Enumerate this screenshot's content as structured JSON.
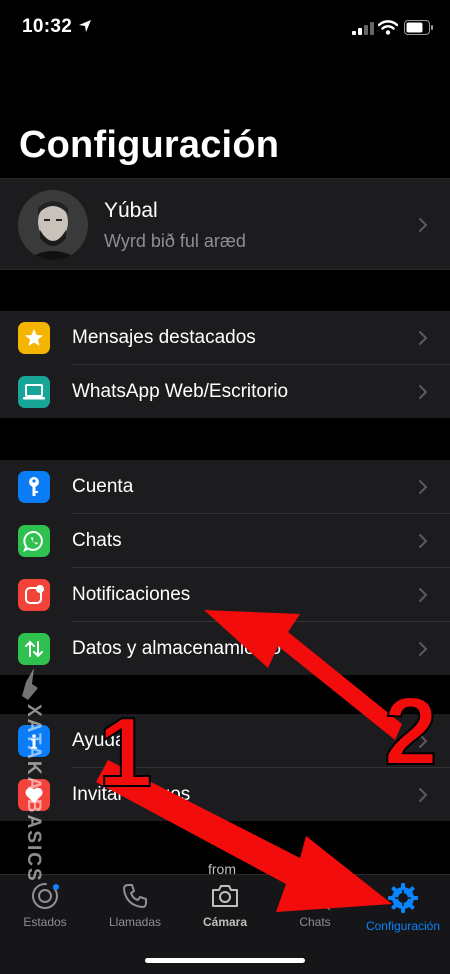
{
  "status_bar": {
    "time": "10:32"
  },
  "page": {
    "title": "Configuración"
  },
  "profile": {
    "name": "Yúbal",
    "status": "Wyrd bið ful aræd"
  },
  "groups": [
    {
      "items": [
        {
          "label": "Mensajes destacados",
          "icon": "star-icon",
          "color": "#f5b400"
        },
        {
          "label": "WhatsApp Web/Escritorio",
          "icon": "laptop-icon",
          "color": "#16a596"
        }
      ]
    },
    {
      "items": [
        {
          "label": "Cuenta",
          "icon": "key-icon",
          "color": "#0a7cf5"
        },
        {
          "label": "Chats",
          "icon": "whatsapp-icon",
          "color": "#2fc050"
        },
        {
          "label": "Notificaciones",
          "icon": "notification-icon",
          "color": "#f2423a"
        },
        {
          "label": "Datos y almacenamiento",
          "icon": "data-arrows-icon",
          "color": "#2fc050"
        }
      ]
    },
    {
      "items": [
        {
          "label": "Ayuda",
          "icon": "info-icon",
          "color": "#0a7cf5"
        },
        {
          "label": "Invitar amigos",
          "icon": "heart-icon",
          "color": "#f2423a"
        }
      ]
    }
  ],
  "from_label": "from",
  "tabs": [
    {
      "label": "Estados",
      "icon": "status-icon",
      "active": false
    },
    {
      "label": "Llamadas",
      "icon": "phone-icon",
      "active": false
    },
    {
      "label": "Cámara",
      "icon": "camera-icon",
      "active": false
    },
    {
      "label": "Chats",
      "icon": "chats-icon",
      "active": false
    },
    {
      "label": "Configuración",
      "icon": "gear-icon",
      "active": true
    }
  ],
  "annotations": {
    "number_1": "1",
    "number_2": "2",
    "arrow_color": "#f20c0c"
  },
  "watermark": {
    "text": "XATAKA BASICS"
  },
  "colors": {
    "accent": "#0a84ff",
    "background": "#000000",
    "cell": "#1c1c1e",
    "secondary_text": "#8e8e93"
  }
}
